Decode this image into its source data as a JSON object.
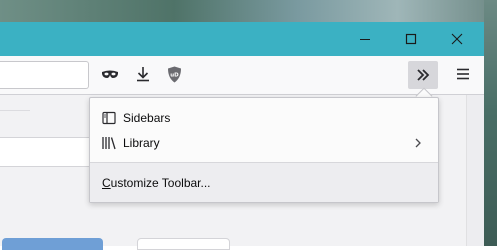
{
  "window": {
    "controls": {
      "minimize": "minimize-icon",
      "maximize": "maximize-icon",
      "close": "close-icon"
    },
    "titlebar_color": "#3bb1c3"
  },
  "toolbar": {
    "icons": [
      "private-mask-icon",
      "download-icon",
      "ublock-shield-icon"
    ],
    "shield_label": "uD",
    "overflow_icon": "double-chevron-icon",
    "menu_icon": "hamburger-menu-icon"
  },
  "overflow_menu": {
    "items": [
      {
        "label": "Sidebars",
        "icon": "sidebar-icon",
        "has_submenu": false
      },
      {
        "label": "Library",
        "icon": "library-icon",
        "has_submenu": true
      }
    ],
    "footer_label": "Customize Toolbar...",
    "footer_underline_char": "C"
  }
}
